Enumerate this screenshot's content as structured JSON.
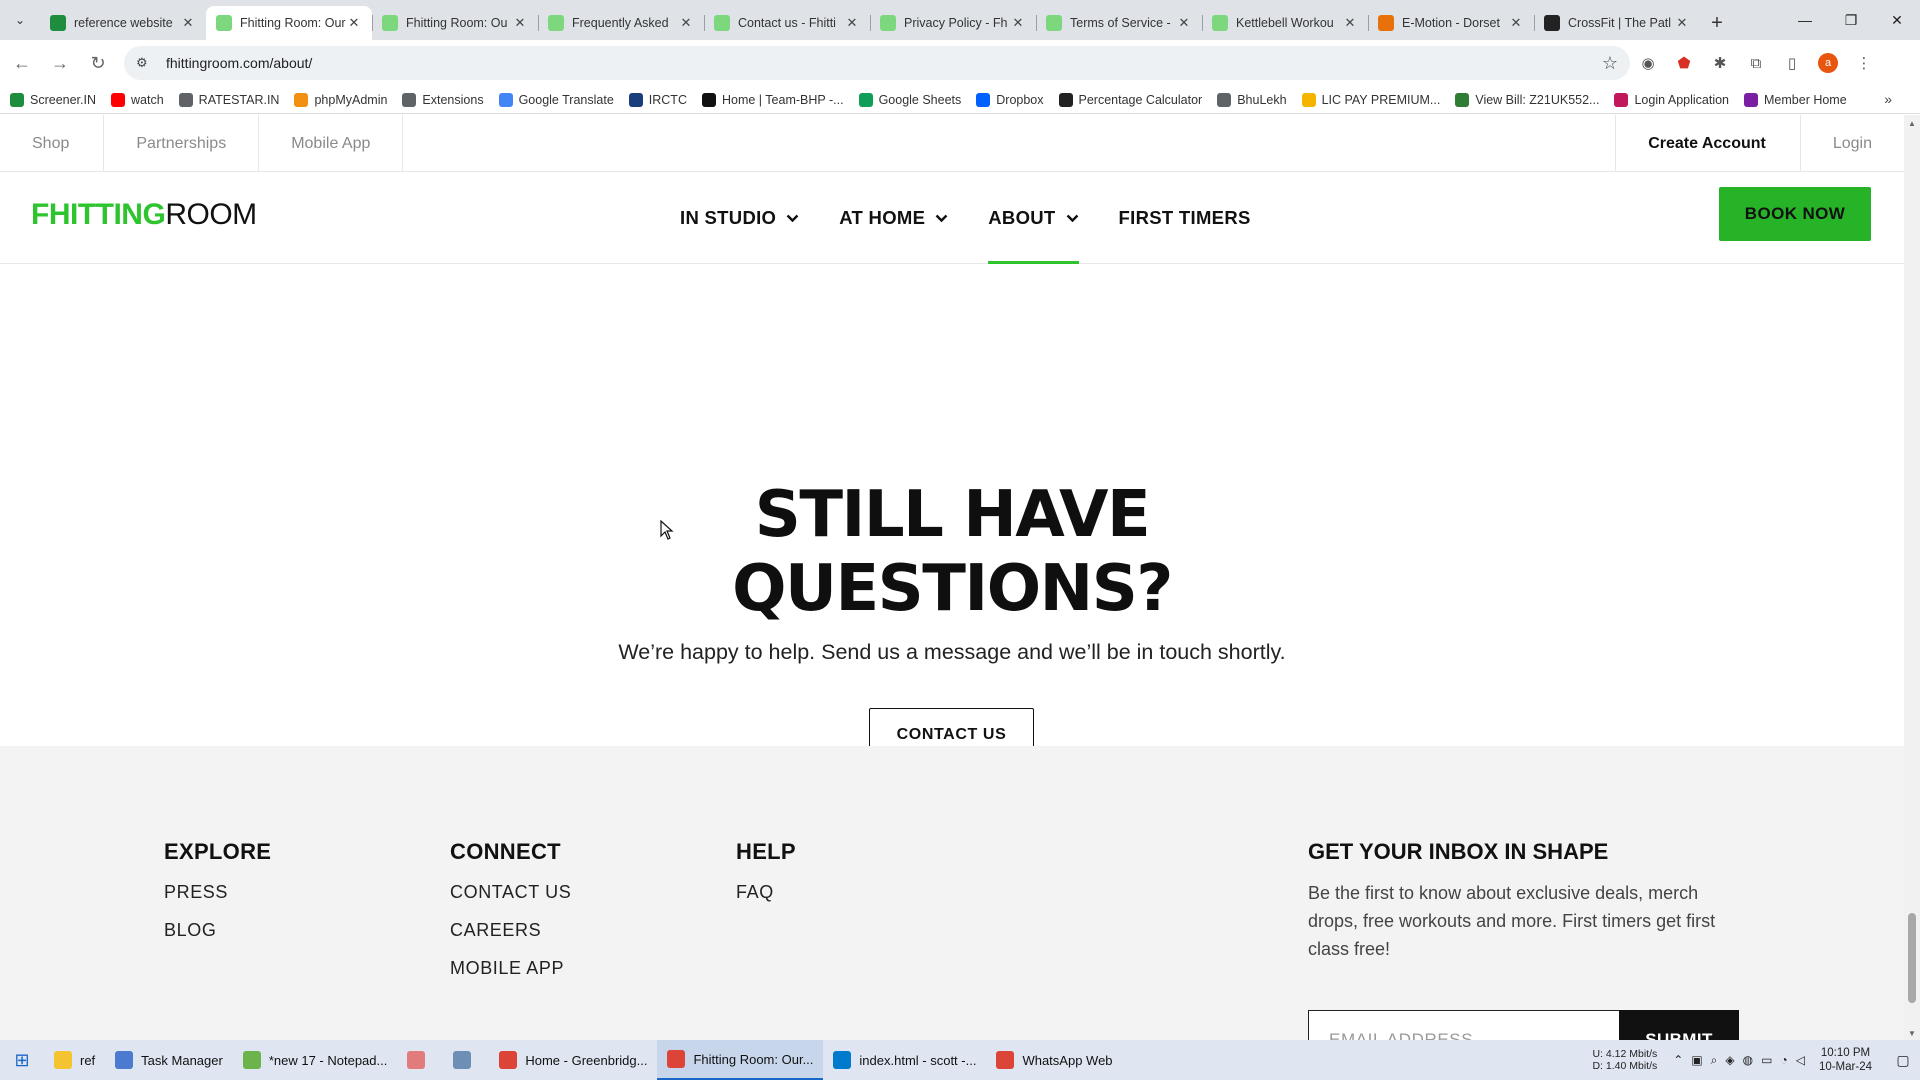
{
  "browser": {
    "tabs": [
      {
        "title": "reference website",
        "favicon_color": "#1e8e3e",
        "active": false
      },
      {
        "title": "Fhitting Room: Our",
        "favicon_color": "#7dd87d",
        "active": true
      },
      {
        "title": "Fhitting Room: Ou",
        "favicon_color": "#7dd87d",
        "active": false
      },
      {
        "title": "Frequently Asked",
        "favicon_color": "#7dd87d",
        "active": false
      },
      {
        "title": "Contact us - Fhitti",
        "favicon_color": "#7dd87d",
        "active": false
      },
      {
        "title": "Privacy Policy - Fh",
        "favicon_color": "#7dd87d",
        "active": false
      },
      {
        "title": "Terms of Service -",
        "favicon_color": "#7dd87d",
        "active": false
      },
      {
        "title": "Kettlebell Workou",
        "favicon_color": "#7dd87d",
        "active": false
      },
      {
        "title": "E-Motion - Dorset",
        "favicon_color": "#e8710a",
        "active": false
      },
      {
        "title": "CrossFit | The Patl",
        "favicon_color": "#222222",
        "active": false
      }
    ],
    "url": "fhittingroom.com/about/",
    "profile_initial": "a",
    "bookmarks": [
      {
        "label": "Screener.IN",
        "color": "#1e8e3e"
      },
      {
        "label": "watch",
        "color": "#ff0000"
      },
      {
        "label": "RATESTAR.IN",
        "color": "#5f6368"
      },
      {
        "label": "phpMyAdmin",
        "color": "#f29111"
      },
      {
        "label": "Extensions",
        "color": "#5f6368"
      },
      {
        "label": "Google Translate",
        "color": "#4285f4"
      },
      {
        "label": "IRCTC",
        "color": "#1a3d7c"
      },
      {
        "label": "Home | Team-BHP -...",
        "color": "#111111"
      },
      {
        "label": "Google Sheets",
        "color": "#0f9d58"
      },
      {
        "label": "Dropbox",
        "color": "#0061fe"
      },
      {
        "label": "Percentage Calculator",
        "color": "#222222"
      },
      {
        "label": "BhuLekh",
        "color": "#5f6368"
      },
      {
        "label": "LIC PAY PREMIUM...",
        "color": "#f4b400"
      },
      {
        "label": "View Bill: Z21UK552...",
        "color": "#2e7d32"
      },
      {
        "label": "Login Application",
        "color": "#c2185b"
      },
      {
        "label": "Member Home",
        "color": "#7b1fa2"
      }
    ]
  },
  "site": {
    "util_left": [
      "Shop",
      "Partnerships",
      "Mobile App"
    ],
    "create_account": "Create Account",
    "login": "Login",
    "logo_bold": "FHITTING",
    "logo_light": "ROOM",
    "nav": [
      {
        "label": "IN STUDIO",
        "has_dropdown": true,
        "active": false
      },
      {
        "label": "AT HOME",
        "has_dropdown": true,
        "active": false
      },
      {
        "label": "ABOUT",
        "has_dropdown": true,
        "active": true
      },
      {
        "label": "FIRST TIMERS",
        "has_dropdown": false,
        "active": false
      }
    ],
    "book_now": "BOOK NOW",
    "accent_color": "#2ec42e",
    "cta": {
      "heading_line1": "STILL HAVE",
      "heading_line2": "QUESTIONS?",
      "subtext": "We’re happy to help. Send us a message and we’ll be in touch shortly.",
      "button": "CONTACT US"
    },
    "footer": {
      "explore": {
        "title": "EXPLORE",
        "links": [
          "PRESS",
          "BLOG"
        ]
      },
      "connect": {
        "title": "CONNECT",
        "links": [
          "CONTACT US",
          "CAREERS",
          "MOBILE APP"
        ]
      },
      "help": {
        "title": "HELP",
        "links": [
          "FAQ"
        ]
      },
      "newsletter": {
        "title": "GET YOUR INBOX IN SHAPE",
        "text": "Be the first to know about exclusive deals, merch drops, free workouts and more. First timers get first class free!",
        "email_placeholder": "EMAIL ADDRESS",
        "submit": "SUBMIT"
      }
    }
  },
  "taskbar": {
    "items": [
      {
        "label": "ref",
        "color": "#f4c430",
        "active": false
      },
      {
        "label": "Task Manager",
        "color": "#4a7bd0",
        "active": false
      },
      {
        "label": "*new 17 - Notepad...",
        "color": "#6bb34a",
        "active": false
      },
      {
        "label": "",
        "color": "#e27b7b",
        "active": false
      },
      {
        "label": "",
        "color": "#6d8fb5",
        "active": false
      },
      {
        "label": "Home - Greenbridg...",
        "color": "#db4437",
        "active": false
      },
      {
        "label": "Fhitting Room: Our...",
        "color": "#db4437",
        "active": true
      },
      {
        "label": "index.html - scott -...",
        "color": "#007acc",
        "active": false
      },
      {
        "label": "WhatsApp Web",
        "color": "#db4437",
        "active": false
      }
    ],
    "net_up": "U:  4.12 Mbit/s",
    "net_down": "D:  1.40 Mbit/s",
    "time": "10:10 PM",
    "date": "10-Mar-24"
  }
}
